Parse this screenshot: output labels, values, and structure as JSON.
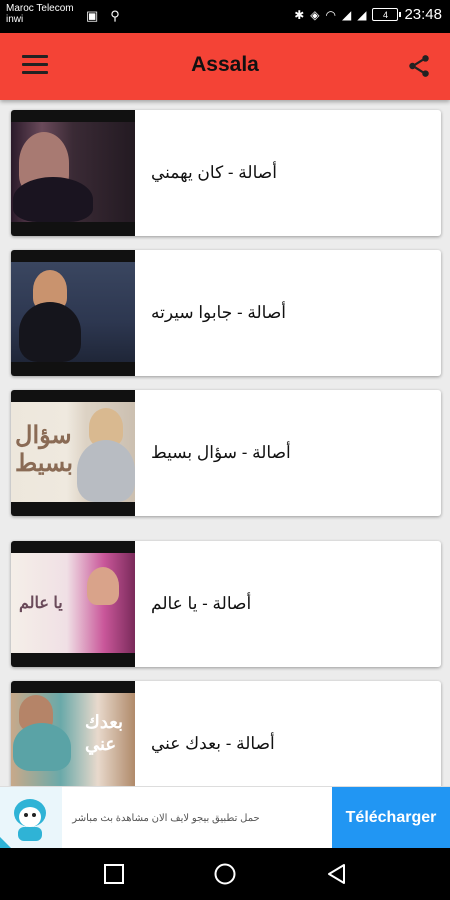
{
  "status_bar": {
    "carrier": "Maroc Telecom\ninwi",
    "battery": "4",
    "time": "23:48"
  },
  "app_bar": {
    "title": "Assala",
    "menu_icon": "hamburger-menu-icon",
    "share_icon": "share-icon",
    "color": "#f44336"
  },
  "songs": [
    {
      "title": "أصالة - كان يهمني"
    },
    {
      "title": "أصالة - جابوا سيرته"
    },
    {
      "title": "أصالة - سؤال بسيط"
    },
    {
      "title": "أصالة - يا عالم"
    },
    {
      "title": "أصالة - بعدك عني"
    }
  ],
  "ad": {
    "text": "حمل تطبيق بيجو لايف الان مشاهدة بث مباشر",
    "button_label": "Télécharger",
    "button_color": "#2196f3"
  },
  "nav_bar": {
    "recent_icon": "recent-apps-icon",
    "home_icon": "home-icon",
    "back_icon": "back-icon"
  }
}
